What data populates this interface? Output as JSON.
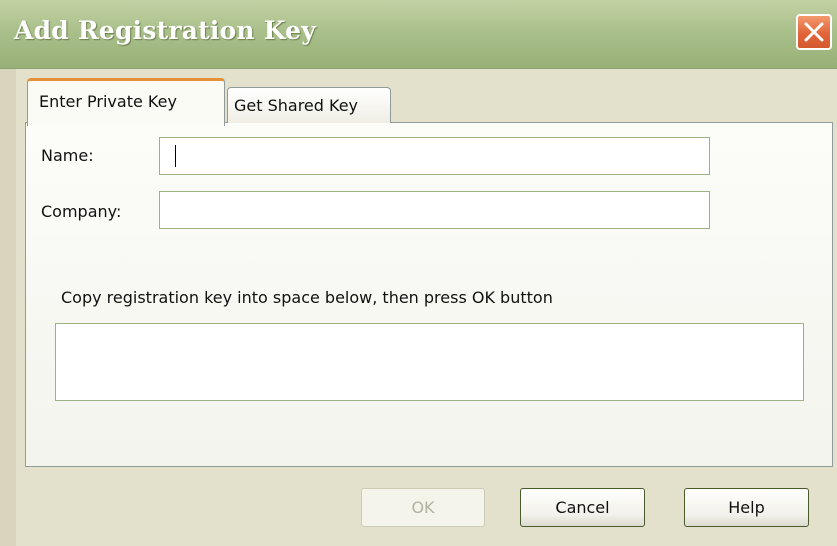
{
  "window": {
    "title": "Add Registration Key"
  },
  "tabs": [
    {
      "label": "Enter Private Key",
      "active": true
    },
    {
      "label": "Get Shared Key",
      "active": false
    }
  ],
  "form": {
    "name_label": "Name:",
    "name_value": "",
    "company_label": "Company:",
    "company_value": "",
    "instruction": "Copy registration key into space below, then press OK button",
    "key_value": ""
  },
  "buttons": {
    "ok": {
      "label": "OK",
      "enabled": false
    },
    "cancel": {
      "label": "Cancel",
      "enabled": true
    },
    "help": {
      "label": "Help",
      "enabled": true
    }
  },
  "colors": {
    "title_bar": "#aac08b",
    "close_button": "#e2643a",
    "active_tab_accent": "#e6913a",
    "input_border": "#9cb284",
    "dialog_background": "#e3e0cc"
  },
  "icons": {
    "close": "close-icon"
  }
}
